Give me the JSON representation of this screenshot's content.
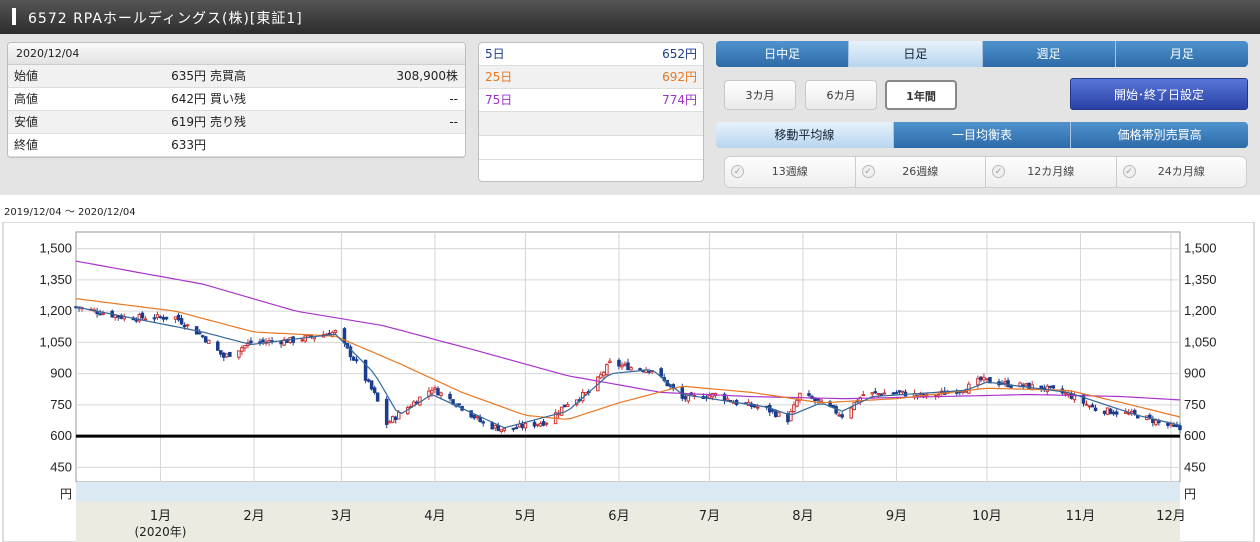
{
  "header": {
    "title": "6572 RPAホールディングス(株)[東証1]"
  },
  "quote": {
    "date": "2020/12/04",
    "rows": [
      {
        "label": "始値",
        "value": "635円",
        "label2": "売買高",
        "value2": "308,900株"
      },
      {
        "label": "高値",
        "value": "642円",
        "label2": "買い残",
        "value2": "--"
      },
      {
        "label": "安値",
        "value": "619円",
        "label2": "売り残",
        "value2": "--"
      },
      {
        "label": "終値",
        "value": "633円",
        "label2": "",
        "value2": ""
      }
    ]
  },
  "moving_averages": [
    {
      "label": "5日",
      "value": "652円",
      "color": "#1a3c8c"
    },
    {
      "label": "25日",
      "value": "692円",
      "color": "#e87722"
    },
    {
      "label": "75日",
      "value": "774円",
      "color": "#9933cc"
    }
  ],
  "period_tabs": [
    {
      "label": "日中足",
      "active": false
    },
    {
      "label": "日足",
      "active": true
    },
    {
      "label": "週足",
      "active": false
    },
    {
      "label": "月足",
      "active": false
    }
  ],
  "range_buttons": [
    {
      "label": "3カ月",
      "active": false
    },
    {
      "label": "6カ月",
      "active": false
    },
    {
      "label": "1年間",
      "active": true
    }
  ],
  "set_dates_button": "開始･終了日設定",
  "indicator_tabs": [
    {
      "label": "移動平均線",
      "active": true
    },
    {
      "label": "一目均衡表",
      "active": false
    },
    {
      "label": "価格帯別売買高",
      "active": false
    }
  ],
  "line_options": [
    {
      "label": "13週線",
      "icon": "check-icon"
    },
    {
      "label": "26週線",
      "icon": "check-icon"
    },
    {
      "label": "12カ月線",
      "icon": "check-icon"
    },
    {
      "label": "24カ月線",
      "icon": "check-icon"
    }
  ],
  "range_text": "2019/12/04 〜 2020/12/04",
  "chart_data": {
    "type": "candlestick",
    "unit": "円",
    "ylim": [
      380,
      1580
    ],
    "yticks": [
      450,
      600,
      750,
      900,
      1050,
      1200,
      1350,
      1500
    ],
    "ytick_labels": [
      "450",
      "600",
      "750",
      "900",
      "1,050",
      "1,200",
      "1,350",
      "1,500"
    ],
    "reference_line": 600,
    "x_date_range": [
      "2019-12-04",
      "2020-12-04"
    ],
    "months": [
      {
        "label": "1月",
        "sub": "(2020年)",
        "date": "2020-01-01"
      },
      {
        "label": "2月",
        "sub": "",
        "date": "2020-02-01"
      },
      {
        "label": "3月",
        "sub": "",
        "date": "2020-03-01"
      },
      {
        "label": "4月",
        "sub": "",
        "date": "2020-04-01"
      },
      {
        "label": "5月",
        "sub": "",
        "date": "2020-05-01"
      },
      {
        "label": "6月",
        "sub": "",
        "date": "2020-06-01"
      },
      {
        "label": "7月",
        "sub": "",
        "date": "2020-07-01"
      },
      {
        "label": "8月",
        "sub": "",
        "date": "2020-08-01"
      },
      {
        "label": "9月",
        "sub": "",
        "date": "2020-09-01"
      },
      {
        "label": "10月",
        "sub": "",
        "date": "2020-10-01"
      },
      {
        "label": "11月",
        "sub": "",
        "date": "2020-11-01"
      },
      {
        "label": "12月",
        "sub": "",
        "date": "2020-12-01"
      }
    ],
    "close_anchors": [
      {
        "date": "2019-12-04",
        "value": 1220
      },
      {
        "date": "2019-12-20",
        "value": 1170
      },
      {
        "date": "2020-01-06",
        "value": 1170
      },
      {
        "date": "2020-01-15",
        "value": 1080
      },
      {
        "date": "2020-01-22",
        "value": 980
      },
      {
        "date": "2020-01-31",
        "value": 1050
      },
      {
        "date": "2020-02-14",
        "value": 1060
      },
      {
        "date": "2020-02-28",
        "value": 1100
      },
      {
        "date": "2020-03-06",
        "value": 950
      },
      {
        "date": "2020-03-12",
        "value": 800
      },
      {
        "date": "2020-03-16",
        "value": 660
      },
      {
        "date": "2020-03-24",
        "value": 750
      },
      {
        "date": "2020-03-31",
        "value": 830
      },
      {
        "date": "2020-04-08",
        "value": 760
      },
      {
        "date": "2020-04-17",
        "value": 660
      },
      {
        "date": "2020-04-24",
        "value": 630
      },
      {
        "date": "2020-05-08",
        "value": 670
      },
      {
        "date": "2020-05-15",
        "value": 760
      },
      {
        "date": "2020-05-22",
        "value": 810
      },
      {
        "date": "2020-05-29",
        "value": 950
      },
      {
        "date": "2020-06-05",
        "value": 930
      },
      {
        "date": "2020-06-12",
        "value": 920
      },
      {
        "date": "2020-06-22",
        "value": 780
      },
      {
        "date": "2020-07-03",
        "value": 800
      },
      {
        "date": "2020-07-10",
        "value": 760
      },
      {
        "date": "2020-07-20",
        "value": 730
      },
      {
        "date": "2020-07-27",
        "value": 680
      },
      {
        "date": "2020-07-31",
        "value": 800
      },
      {
        "date": "2020-08-07",
        "value": 760
      },
      {
        "date": "2020-08-14",
        "value": 700
      },
      {
        "date": "2020-08-21",
        "value": 800
      },
      {
        "date": "2020-09-01",
        "value": 810
      },
      {
        "date": "2020-09-11",
        "value": 790
      },
      {
        "date": "2020-09-24",
        "value": 830
      },
      {
        "date": "2020-09-29",
        "value": 870
      },
      {
        "date": "2020-10-08",
        "value": 850
      },
      {
        "date": "2020-10-20",
        "value": 830
      },
      {
        "date": "2020-10-28",
        "value": 800
      },
      {
        "date": "2020-11-06",
        "value": 730
      },
      {
        "date": "2020-11-20",
        "value": 700
      },
      {
        "date": "2020-12-04",
        "value": 633
      }
    ],
    "ma5_anchors": [
      {
        "date": "2019-12-04",
        "value": 1220
      },
      {
        "date": "2020-01-15",
        "value": 1100
      },
      {
        "date": "2020-01-31",
        "value": 1040
      },
      {
        "date": "2020-02-28",
        "value": 1090
      },
      {
        "date": "2020-03-12",
        "value": 900
      },
      {
        "date": "2020-03-20",
        "value": 700
      },
      {
        "date": "2020-03-31",
        "value": 800
      },
      {
        "date": "2020-04-24",
        "value": 640
      },
      {
        "date": "2020-05-15",
        "value": 720
      },
      {
        "date": "2020-05-29",
        "value": 900
      },
      {
        "date": "2020-06-12",
        "value": 920
      },
      {
        "date": "2020-06-22",
        "value": 800
      },
      {
        "date": "2020-07-20",
        "value": 740
      },
      {
        "date": "2020-07-28",
        "value": 700
      },
      {
        "date": "2020-08-07",
        "value": 760
      },
      {
        "date": "2020-08-14",
        "value": 720
      },
      {
        "date": "2020-08-24",
        "value": 790
      },
      {
        "date": "2020-09-24",
        "value": 820
      },
      {
        "date": "2020-10-01",
        "value": 860
      },
      {
        "date": "2020-10-28",
        "value": 810
      },
      {
        "date": "2020-11-20",
        "value": 700
      },
      {
        "date": "2020-12-04",
        "value": 652
      }
    ],
    "ma25_anchors": [
      {
        "date": "2019-12-04",
        "value": 1260
      },
      {
        "date": "2020-01-06",
        "value": 1200
      },
      {
        "date": "2020-02-01",
        "value": 1100
      },
      {
        "date": "2020-02-28",
        "value": 1080
      },
      {
        "date": "2020-03-20",
        "value": 950
      },
      {
        "date": "2020-04-10",
        "value": 810
      },
      {
        "date": "2020-05-01",
        "value": 700
      },
      {
        "date": "2020-05-15",
        "value": 680
      },
      {
        "date": "2020-06-01",
        "value": 760
      },
      {
        "date": "2020-06-22",
        "value": 840
      },
      {
        "date": "2020-07-15",
        "value": 810
      },
      {
        "date": "2020-08-07",
        "value": 760
      },
      {
        "date": "2020-09-01",
        "value": 780
      },
      {
        "date": "2020-10-01",
        "value": 830
      },
      {
        "date": "2020-10-28",
        "value": 820
      },
      {
        "date": "2020-11-15",
        "value": 760
      },
      {
        "date": "2020-12-04",
        "value": 692
      }
    ],
    "ma75_anchors": [
      {
        "date": "2019-12-04",
        "value": 1440
      },
      {
        "date": "2020-01-15",
        "value": 1330
      },
      {
        "date": "2020-02-15",
        "value": 1200
      },
      {
        "date": "2020-03-15",
        "value": 1130
      },
      {
        "date": "2020-04-15",
        "value": 1010
      },
      {
        "date": "2020-05-15",
        "value": 890
      },
      {
        "date": "2020-06-15",
        "value": 810
      },
      {
        "date": "2020-07-15",
        "value": 790
      },
      {
        "date": "2020-08-15",
        "value": 780
      },
      {
        "date": "2020-09-15",
        "value": 790
      },
      {
        "date": "2020-10-15",
        "value": 800
      },
      {
        "date": "2020-11-15",
        "value": 790
      },
      {
        "date": "2020-12-04",
        "value": 774
      }
    ],
    "series_colors": {
      "up": "#cc3333",
      "down": "#1a3c8c",
      "ma5": "#336699",
      "ma25": "#e87722",
      "ma75": "#aa33cc"
    }
  }
}
